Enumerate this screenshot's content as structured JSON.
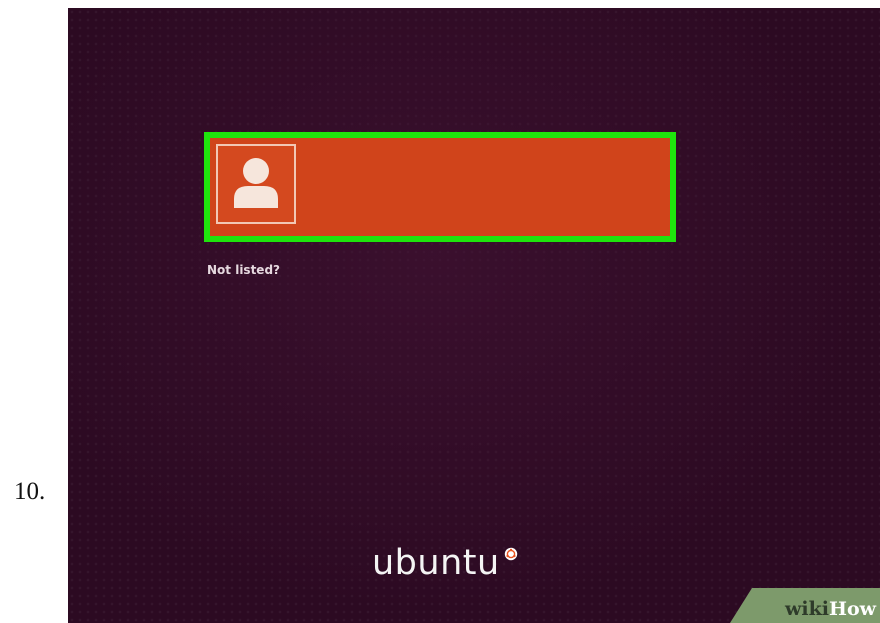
{
  "step": {
    "number": "10."
  },
  "login": {
    "user_icon": "user-avatar-icon",
    "user_name": "",
    "not_listed_label": "Not listed?"
  },
  "branding": {
    "logo_text": "ubuntu",
    "logo_mark_icon": "circle-of-friends-icon",
    "watermark_part_a": "wiki",
    "watermark_part_b": "How"
  },
  "colors": {
    "background": "#2c0a22",
    "user_row": "#d0441b",
    "highlight": "#1fe40d",
    "watermark_bg": "#7d9a6b"
  }
}
